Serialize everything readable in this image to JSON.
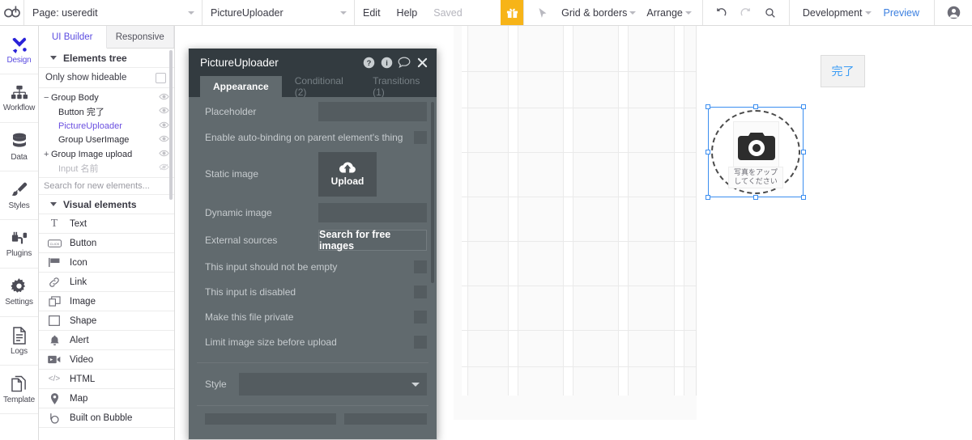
{
  "topbar": {
    "logo_icon": "bubble-logo-icon",
    "page_select": {
      "label": "Page: useredit",
      "caret": "chevron-down-icon"
    },
    "element_select": {
      "label": "PictureUploader",
      "caret": "chevron-down-icon"
    },
    "edit_label": "Edit",
    "help_label": "Help",
    "saved_label": "Saved",
    "gift_icon": "gift-icon",
    "cursor_icon": "cursor-arrow-icon",
    "grid_borders_label": "Grid & borders",
    "arrange_label": "Arrange",
    "undo_icon": "undo-icon",
    "redo_icon": "redo-icon",
    "search_icon": "search-icon",
    "version_label": "Development",
    "preview_label": "Preview",
    "avatar_icon": "user-avatar-icon",
    "accent_blue": "#3b7fe0",
    "gift_bg": "#f7b418"
  },
  "rail": {
    "items": [
      {
        "label": "Design",
        "icon": "design-tools-icon",
        "active": true
      },
      {
        "label": "Workflow",
        "icon": "workflow-nodes-icon",
        "active": false
      },
      {
        "label": "Data",
        "icon": "database-icon",
        "active": false
      },
      {
        "label": "Styles",
        "icon": "paintbrush-icon",
        "active": false
      },
      {
        "label": "Plugins",
        "icon": "plug-icon",
        "active": false
      },
      {
        "label": "Settings",
        "icon": "gear-icon",
        "active": false
      },
      {
        "label": "Logs",
        "icon": "document-lines-icon",
        "active": false
      },
      {
        "label": "Template",
        "icon": "template-pages-icon",
        "active": false
      }
    ]
  },
  "elements_panel": {
    "tabs": [
      {
        "label": "UI Builder",
        "active": true
      },
      {
        "label": "Responsive",
        "active": false
      }
    ],
    "tree_section_label": "Elements tree",
    "only_show_hideable_label": "Only show hideable",
    "only_show_hideable_checked": false,
    "tree": [
      {
        "label": "Group Body",
        "toggle": "−",
        "indent": 0,
        "selected": false,
        "dim": false
      },
      {
        "label": "Button 完了",
        "toggle": "",
        "indent": 1,
        "selected": false,
        "dim": false
      },
      {
        "label": "PictureUploader",
        "toggle": "",
        "indent": 1,
        "selected": true,
        "dim": false
      },
      {
        "label": "Group UserImage",
        "toggle": "",
        "indent": 1,
        "selected": false,
        "dim": false
      },
      {
        "label": "Group Image upload",
        "toggle": "+",
        "indent": 0,
        "selected": false,
        "dim": false
      },
      {
        "label": "Input 名前",
        "toggle": "",
        "indent": 1,
        "selected": false,
        "dim": true
      }
    ],
    "search_placeholder": "Search for new elements...",
    "visual_section_label": "Visual elements",
    "visual_elements": [
      {
        "label": "Text",
        "icon": "text-T-icon"
      },
      {
        "label": "Button",
        "icon": "button-click-icon"
      },
      {
        "label": "Icon",
        "icon": "flag-icon"
      },
      {
        "label": "Link",
        "icon": "link-chain-icon"
      },
      {
        "label": "Image",
        "icon": "image-icon"
      },
      {
        "label": "Shape",
        "icon": "square-shape-icon"
      },
      {
        "label": "Alert",
        "icon": "bell-icon"
      },
      {
        "label": "Video",
        "icon": "video-camera-icon"
      },
      {
        "label": "HTML",
        "icon": "code-tags-icon"
      },
      {
        "label": "Map",
        "icon": "map-pin-icon"
      },
      {
        "label": "Built on Bubble",
        "icon": "bubble-b-icon"
      }
    ],
    "collapse_icon": "collapse-left-icon"
  },
  "canvas": {
    "done_button_label": "完了",
    "done_button_color": "#3b9cf5",
    "uploader": {
      "camera_icon": "camera-icon",
      "caption_line1": "写真をアップ",
      "caption_line2": "してください",
      "selection_color": "#3b8ef0"
    }
  },
  "dialog": {
    "title": "PictureUploader",
    "title_icons": [
      {
        "name": "help-circle-icon",
        "glyph": "?"
      },
      {
        "name": "info-circle-icon",
        "glyph": "i"
      },
      {
        "name": "comment-icon",
        "glyph": "◯"
      },
      {
        "name": "close-icon",
        "glyph": "✕"
      }
    ],
    "tabs": [
      {
        "label": "Appearance",
        "active": true
      },
      {
        "label": "Conditional (2)",
        "active": false
      },
      {
        "label": "Transitions (1)",
        "active": false
      }
    ],
    "fields": {
      "placeholder_label": "Placeholder",
      "placeholder_value": "",
      "autobinding_label": "Enable auto-binding on parent element's thing",
      "autobinding_checked": false,
      "static_image_label": "Static image",
      "static_image_button": "Upload",
      "static_image_button_icon": "cloud-upload-icon",
      "dynamic_image_label": "Dynamic image",
      "dynamic_image_value": "",
      "external_sources_label": "External sources",
      "external_sources_button": "Search for free images",
      "not_empty_label": "This input should not be empty",
      "not_empty_checked": false,
      "disabled_label": "This input is disabled",
      "disabled_checked": false,
      "private_label": "Make this file private",
      "private_checked": false,
      "limit_size_label": "Limit image size before upload",
      "limit_size_checked": false,
      "style_label": "Style",
      "style_value": "",
      "style_caret": "chevron-down-icon"
    }
  }
}
